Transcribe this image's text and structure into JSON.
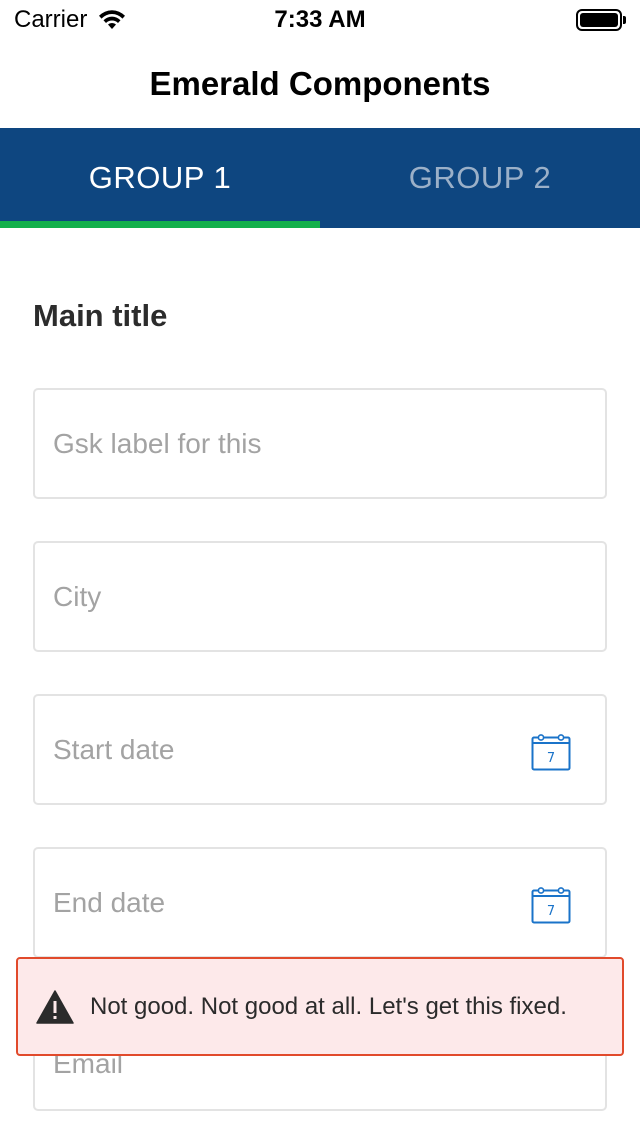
{
  "status_bar": {
    "carrier": "Carrier",
    "time": "7:33 AM"
  },
  "nav": {
    "title": "Emerald Components"
  },
  "tabs": [
    {
      "label": "GROUP 1",
      "active": true
    },
    {
      "label": "GROUP 2",
      "active": false
    }
  ],
  "colors": {
    "tab_bar": "#0e4680",
    "tab_indicator": "#13b04b",
    "calendar_icon": "#1a73c9",
    "toast_background": "#fde9ea",
    "toast_border": "#e14a2b"
  },
  "form": {
    "main_title": "Main title",
    "fields": [
      {
        "placeholder": "Gsk label for this",
        "icon": ""
      },
      {
        "placeholder": "City",
        "icon": ""
      },
      {
        "placeholder": "Start date",
        "icon": "calendar-icon",
        "icon_day": "7"
      },
      {
        "placeholder": "End date",
        "icon": "calendar-icon",
        "icon_day": "7"
      },
      {
        "placeholder": "Email",
        "icon": ""
      }
    ]
  },
  "toast": {
    "icon": "warning-icon",
    "message": "Not good. Not good at all. Let's get this fixed."
  }
}
